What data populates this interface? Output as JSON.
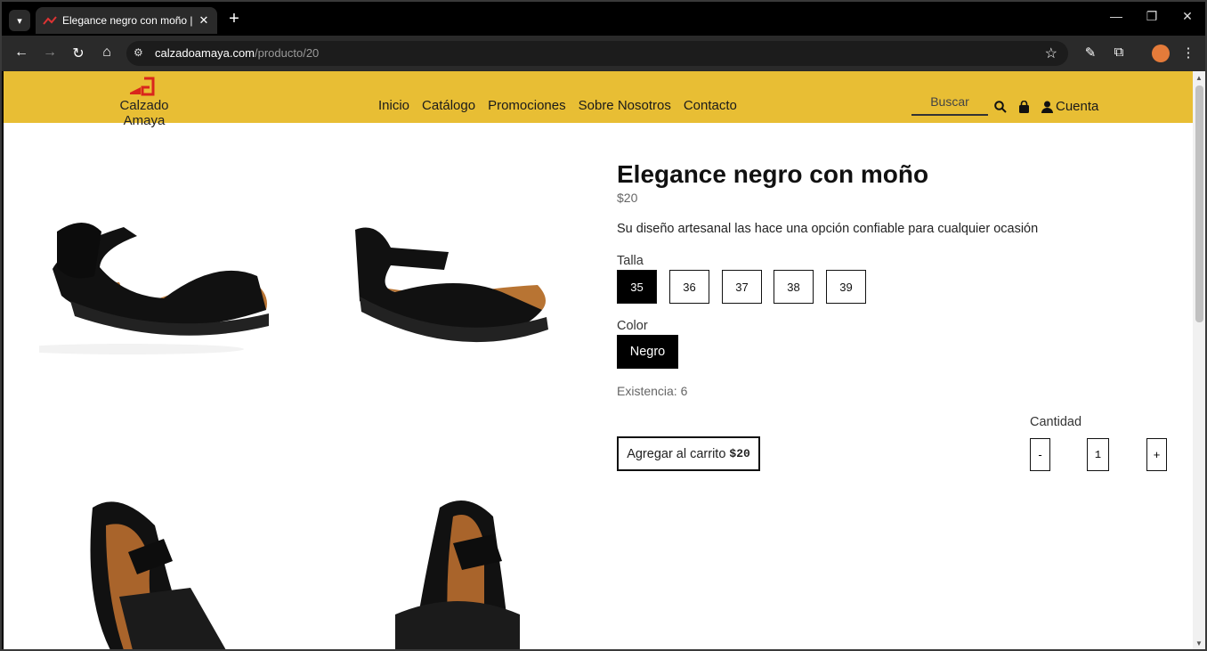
{
  "browser": {
    "tab_title": "Elegance negro con moño | Cal:",
    "url_host": "calzadoamaya.com",
    "url_path": "/producto/20",
    "new_tab": "+",
    "tab_close": "✕"
  },
  "header": {
    "brand": "Calzado Amaya",
    "nav": [
      "Inicio",
      "Catálogo",
      "Promociones",
      "Sobre Nosotros",
      "Contacto"
    ],
    "search_placeholder": "Buscar",
    "account_label": "Cuenta",
    "brand_color": "#e8be34"
  },
  "product": {
    "title": "Elegance negro con moño",
    "price": "$20",
    "description": "Su diseño artesanal las hace una opción confiable para cualquier ocasión",
    "size_label": "Talla",
    "sizes": [
      "35",
      "36",
      "37",
      "38",
      "39"
    ],
    "selected_size": "35",
    "color_label": "Color",
    "color_value": "Negro",
    "stock": "Existencia: 6",
    "add_to_cart": "Agregar al carrito",
    "add_to_cart_price": "$20",
    "quantity_label": "Cantidad",
    "quantity": "1",
    "qty_minus": "-",
    "qty_plus": "+"
  },
  "icons": {
    "search": "search-icon",
    "bag": "shopping-bag-icon",
    "user": "user-icon"
  }
}
